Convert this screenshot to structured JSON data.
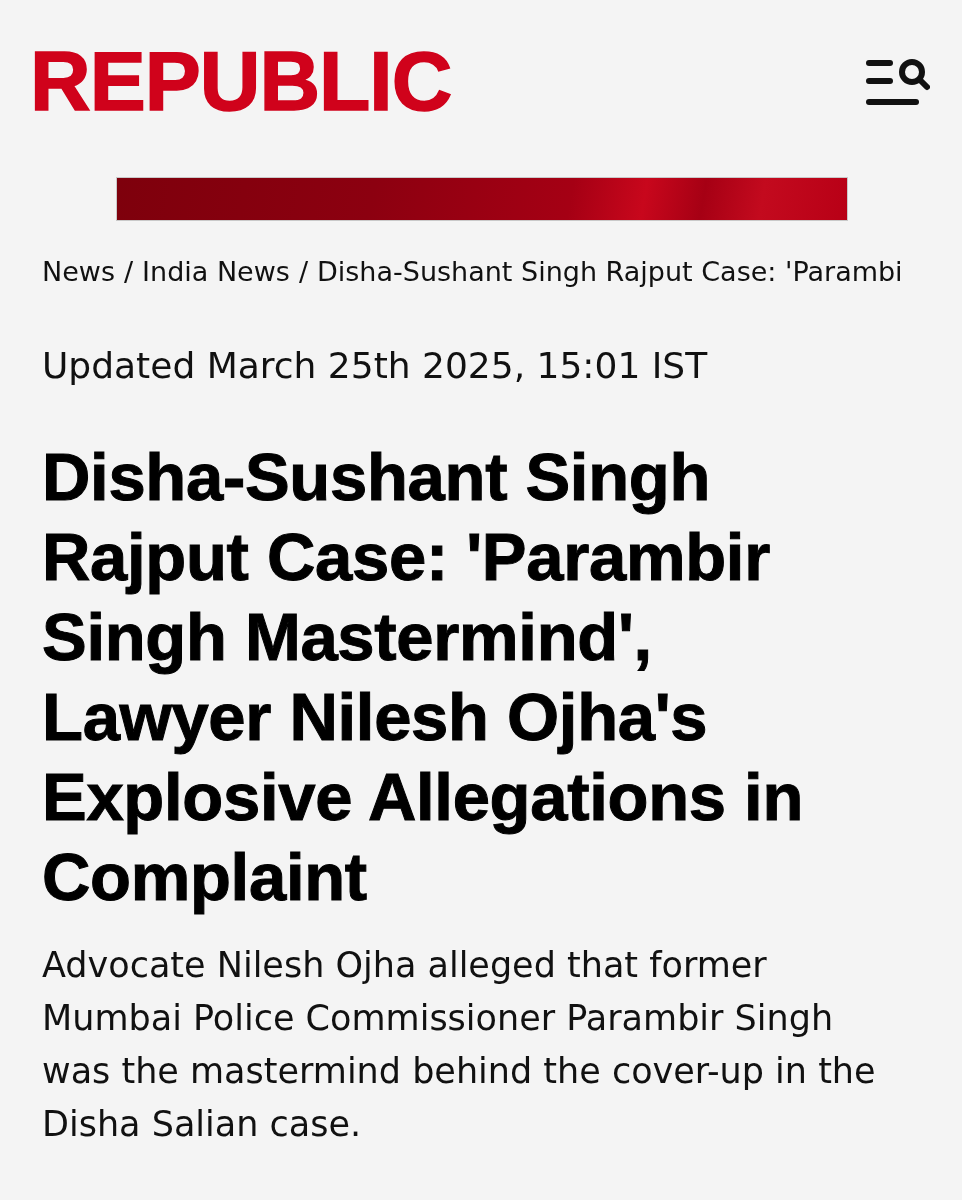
{
  "header": {
    "logo": "REPUBLIC"
  },
  "breadcrumb": {
    "links": [
      "News",
      "India News"
    ],
    "separators": [
      "/",
      "/"
    ],
    "current": "Disha-Sushant Singh Rajput Case: 'Parambi"
  },
  "article": {
    "updated": "Updated March 25th 2025, 15:01 IST",
    "headline": "Disha-Sushant Singh Rajput Case: 'Parambir Singh Mastermind', Lawyer Nilesh Ojha's Explosive Allegations in Complaint",
    "summary": "Advocate Nilesh Ojha alleged that former Mumbai Police Commissioner Parambir Singh was the mastermind behind the cover-up in the Disha Salian case."
  }
}
